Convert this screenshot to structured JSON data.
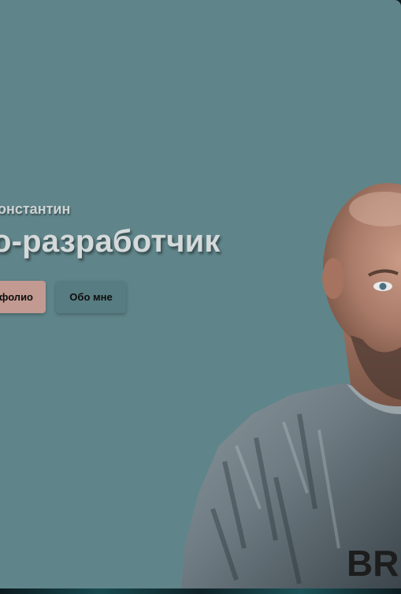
{
  "hero": {
    "greeting": "Константин",
    "headline": "о-разработчик",
    "buttons": {
      "portfolio_label": "фолио",
      "about_label": "Обо мне"
    },
    "portrait_caption": "BR"
  },
  "colors": {
    "background": "#5f858a",
    "primary_button": "#c29a92",
    "secondary_button": "#577c81",
    "text": "#d4d9da"
  }
}
